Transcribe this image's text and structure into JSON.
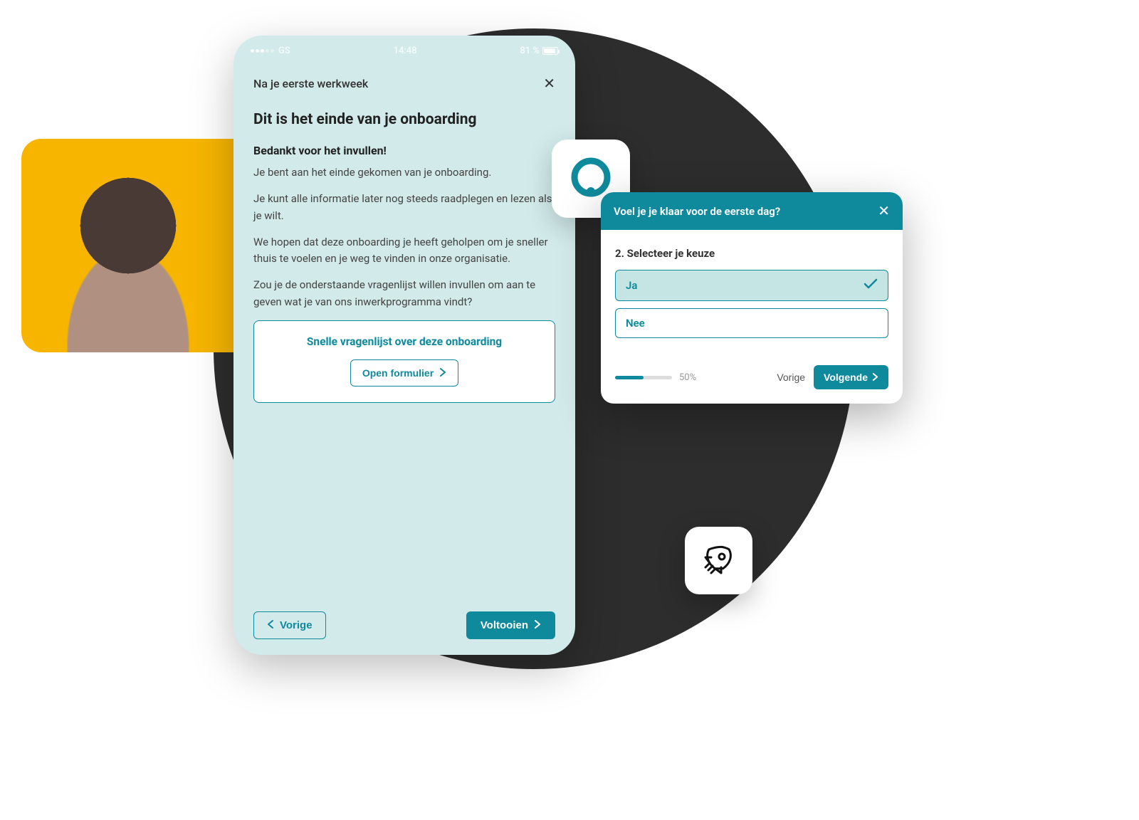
{
  "statusbar": {
    "carrier": "GS",
    "time": "14:48",
    "battery_pct": "81 %"
  },
  "phone": {
    "header_title": "Na je eerste werkweek",
    "heading": "Dit is het einde van je onboarding",
    "subheading": "Bedankt voor het invullen!",
    "p1": "Je bent aan het einde gekomen van je onboarding.",
    "p2": "Je kunt alle informatie later nog steeds raadplegen en lezen als je wilt.",
    "p3": "We hopen dat deze onboarding je heeft geholpen om je sneller thuis te voelen en je weg te vinden in onze organisatie.",
    "p4": "Zou je de onderstaande vragenlijst willen invullen om aan te geven wat je van ons inwerkprogramma vindt?",
    "card_title": "Snelle vragenlijst over deze onboarding",
    "card_button": "Open formulier",
    "prev_label": "Vorige",
    "complete_label": "Voltooien"
  },
  "popup": {
    "title": "Voel je je klaar voor de eerste dag?",
    "question": "2. Selecteer je keuze",
    "option_yes": "Ja",
    "option_no": "Nee",
    "progress_pct": "50%",
    "prev_label": "Vorige",
    "next_label": "Volgende"
  }
}
